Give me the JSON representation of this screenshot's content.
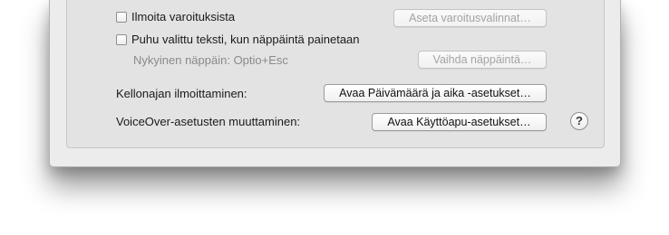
{
  "alerts": {
    "checkbox_label": "Ilmoita varoituksista",
    "checked": false,
    "button_label": "Aseta varoitusvalinnat…",
    "button_enabled": false
  },
  "speak_selection": {
    "checkbox_label": "Puhu valittu teksti, kun näppäintä painetaan",
    "checked": false,
    "current_key_text": "Nykyinen näppäin: Optio+Esc",
    "button_label": "Vaihda näppäintä…",
    "button_enabled": false
  },
  "clock": {
    "label": "Kellonajan ilmoittaminen:",
    "button_label": "Avaa Päivämäärä ja aika -asetukset…"
  },
  "voiceover": {
    "label": "VoiceOver-asetusten muuttaminen:",
    "button_label": "Avaa Käyttöapu-asetukset…"
  },
  "help": {
    "glyph": "?",
    "icon": "help-icon"
  }
}
